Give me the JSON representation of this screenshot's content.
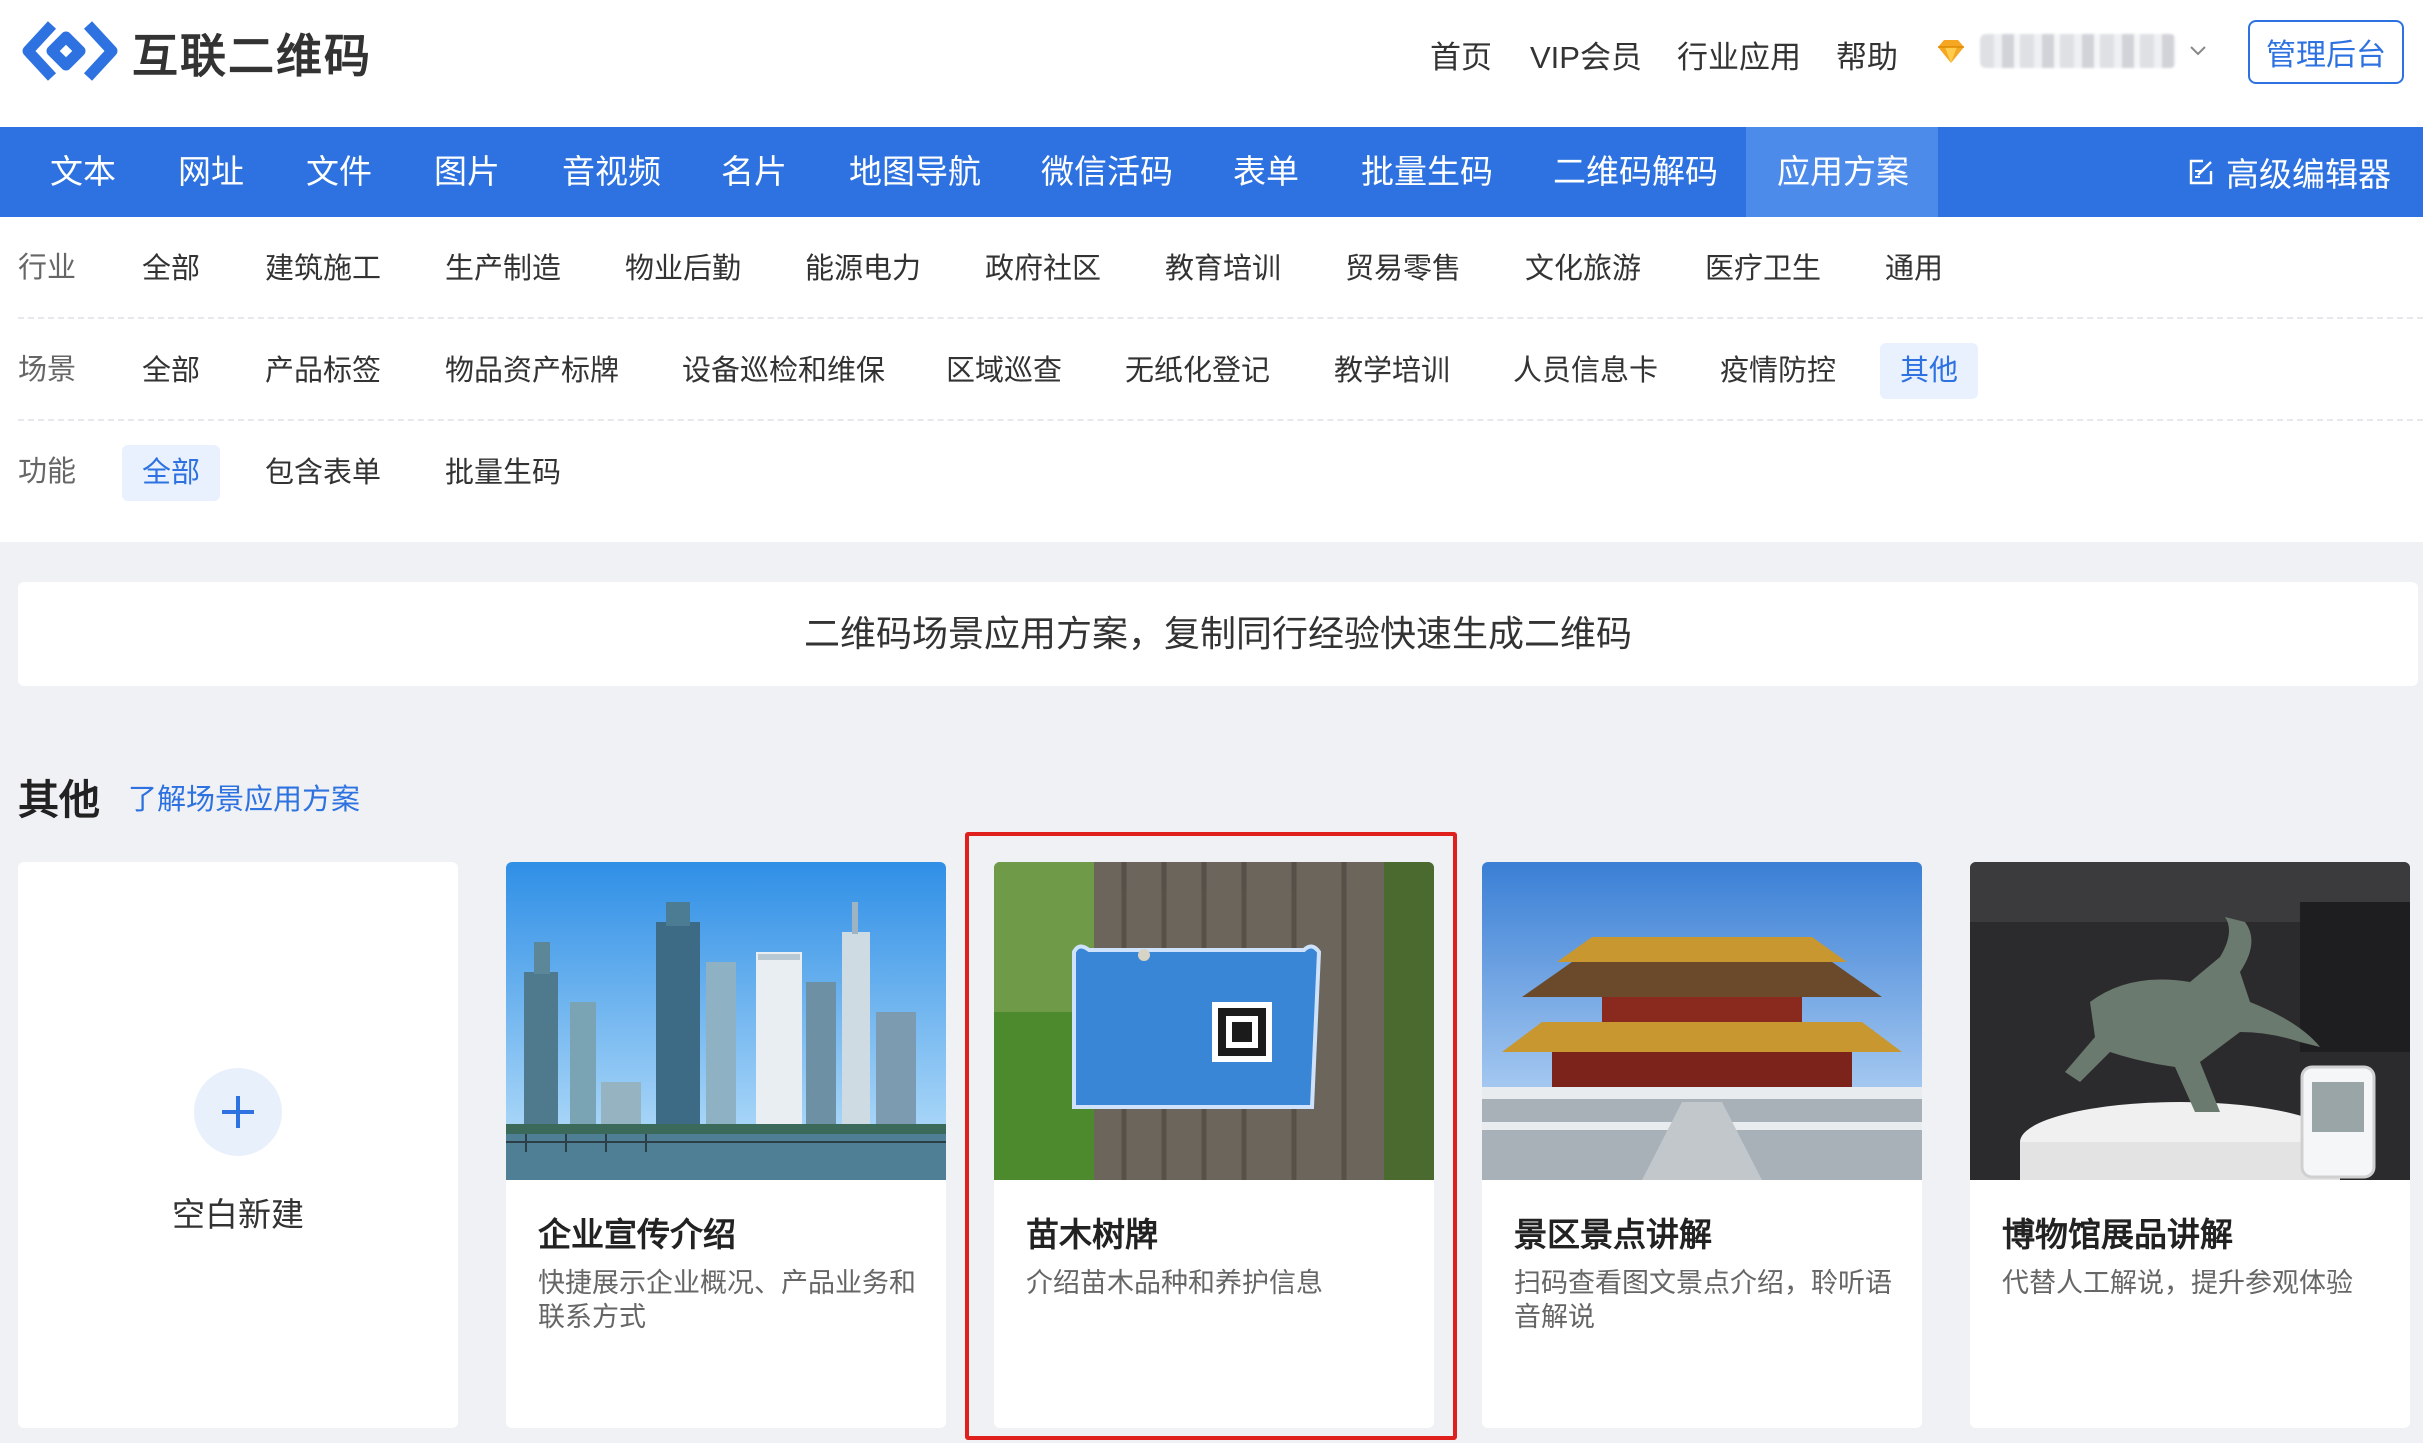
{
  "brand": {
    "name": "互联二维码"
  },
  "top_nav": [
    "首页",
    "VIP会员",
    "行业应用",
    "帮助"
  ],
  "user": {
    "vip_icon": "diamond-icon",
    "dropdown_icon": "chevron-down-icon"
  },
  "admin_button": "管理后台",
  "main_nav": {
    "items": [
      "文本",
      "网址",
      "文件",
      "图片",
      "音视频",
      "名片",
      "地图导航",
      "微信活码",
      "表单",
      "批量生码",
      "二维码解码",
      "应用方案"
    ],
    "active": "应用方案",
    "advanced_editor": "高级编辑器"
  },
  "filters": {
    "industry": {
      "label": "行业",
      "options": [
        "全部",
        "建筑施工",
        "生产制造",
        "物业后勤",
        "能源电力",
        "政府社区",
        "教育培训",
        "贸易零售",
        "文化旅游",
        "医疗卫生",
        "通用"
      ]
    },
    "scene": {
      "label": "场景",
      "options": [
        "全部",
        "产品标签",
        "物品资产标牌",
        "设备巡检和维保",
        "区域巡查",
        "无纸化登记",
        "教学培训",
        "人员信息卡",
        "疫情防控",
        "其他"
      ],
      "active": "其他"
    },
    "function": {
      "label": "功能",
      "options": [
        "全部",
        "包含表单",
        "批量生码"
      ],
      "active": "全部"
    }
  },
  "banner": "二维码场景应用方案，复制同行经验快速生成二维码",
  "section": {
    "title": "其他",
    "link": "了解场景应用方案"
  },
  "cards": [
    {
      "title": "空白新建",
      "type": "blank"
    },
    {
      "title": "企业宣传介绍",
      "desc": "快捷展示企业概况、产品业务和联系方式"
    },
    {
      "title": "苗木树牌",
      "desc": "介绍苗木品种和养护信息",
      "highlighted": true
    },
    {
      "title": "景区景点讲解",
      "desc": "扫码查看图文景点介绍，聆听语音解说"
    },
    {
      "title": "博物馆展品讲解",
      "desc": "代替人工解说，提升参观体验"
    }
  ],
  "colors": {
    "primary": "#2d72e0",
    "highlight_border": "#e0201d"
  }
}
